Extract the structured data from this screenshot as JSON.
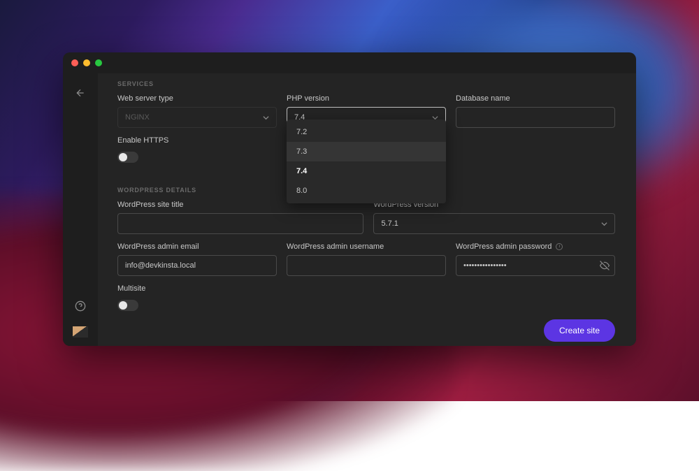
{
  "sections": {
    "services": "SERVICES",
    "wordpress": "WORDPRESS DETAILS"
  },
  "fields": {
    "webserver": {
      "label": "Web server type",
      "value": "NGINX"
    },
    "php": {
      "label": "PHP version",
      "value": "7.4",
      "options": [
        "7.2",
        "7.3",
        "7.4",
        "8.0"
      ]
    },
    "dbname": {
      "label": "Database name",
      "value": ""
    },
    "https": {
      "label": "Enable HTTPS",
      "enabled": false
    },
    "wp_title": {
      "label": "WordPress site title",
      "value": ""
    },
    "wp_version": {
      "label": "WordPress version",
      "value": "5.7.1"
    },
    "wp_email": {
      "label": "WordPress admin email",
      "value": "info@devkinsta.local"
    },
    "wp_user": {
      "label": "WordPress admin username",
      "value": ""
    },
    "wp_pass": {
      "label": "WordPress admin password",
      "value": "••••••••••••••••"
    },
    "multisite": {
      "label": "Multisite",
      "enabled": false
    }
  },
  "buttons": {
    "create": "Create site"
  }
}
